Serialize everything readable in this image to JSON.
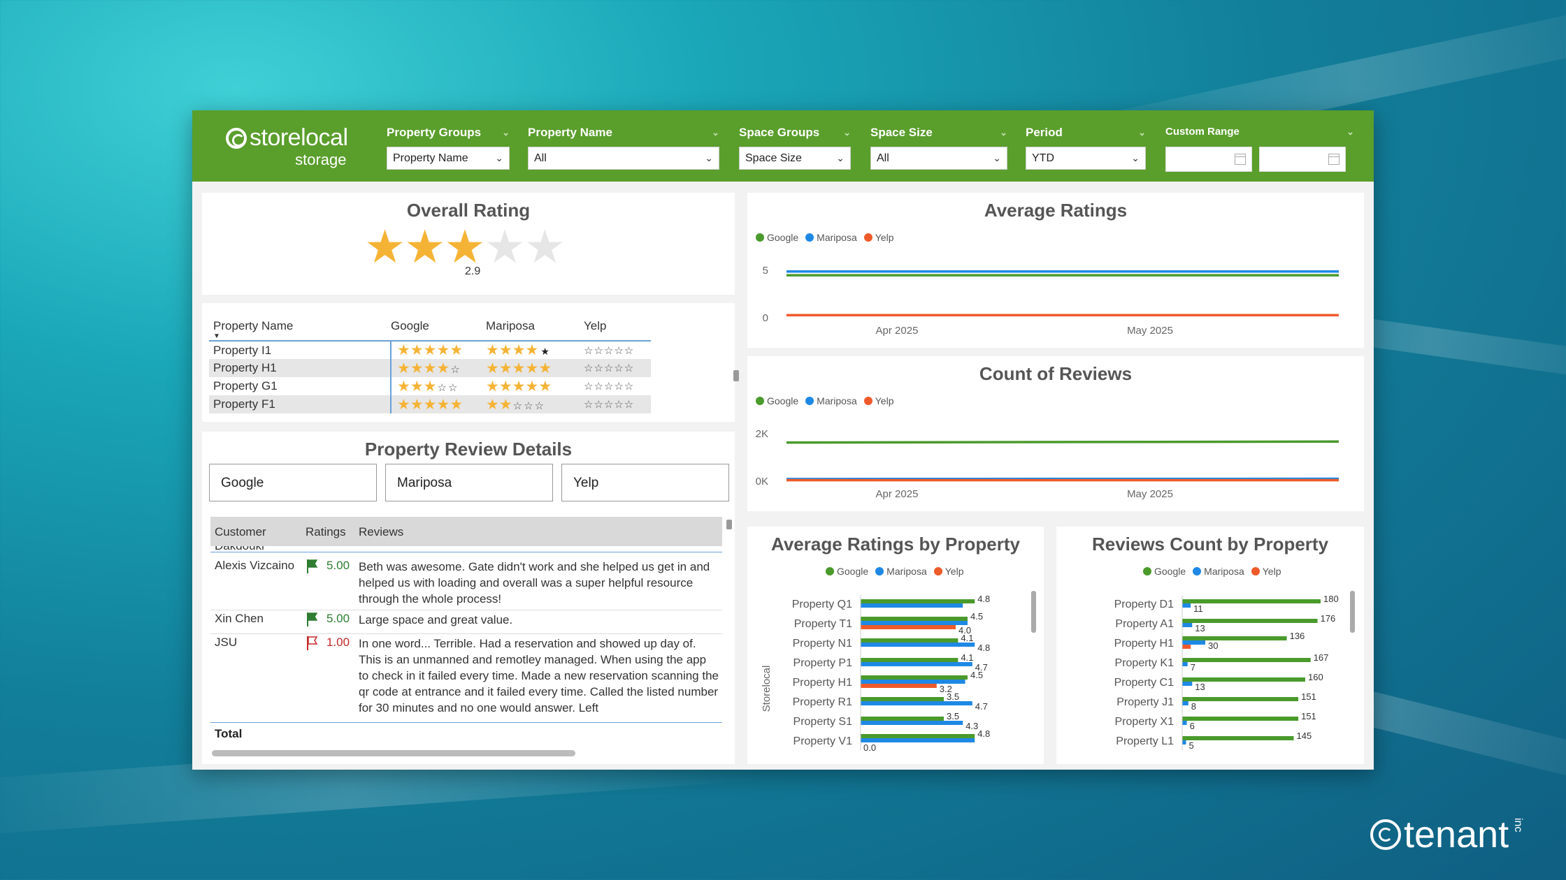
{
  "colors": {
    "google": "#4a9a2c",
    "mariposa": "#1e88e5",
    "yelp": "#ef5a2a",
    "brand_green": "#5a9e2c",
    "star": "#f5b335"
  },
  "header": {
    "logo_main": "storelocal",
    "logo_sub": "storage",
    "filters": [
      {
        "label": "Property Groups",
        "value": "Property Name"
      },
      {
        "label": "Property Name",
        "value": "All"
      },
      {
        "label": "Space Groups",
        "value": "Space Size"
      },
      {
        "label": "Space Size",
        "value": "All"
      },
      {
        "label": "Period",
        "value": "YTD"
      },
      {
        "label": "Custom Range",
        "value": ""
      }
    ]
  },
  "overall": {
    "title": "Overall Rating",
    "value": "2.9",
    "stars_filled": 3,
    "stars_total": 5
  },
  "property_table": {
    "headers": [
      "Property Name",
      "Google",
      "Mariposa",
      "Yelp"
    ],
    "rows": [
      {
        "name": "Property I1",
        "google": 5,
        "mariposa": 4.5,
        "yelp": 0
      },
      {
        "name": "Property H1",
        "google": 4,
        "mariposa": 5,
        "yelp": 0
      },
      {
        "name": "Property G1",
        "google": 3,
        "mariposa": 5,
        "yelp": 0
      },
      {
        "name": "Property F1",
        "google": 5,
        "mariposa": 2,
        "yelp": 0
      }
    ]
  },
  "review_details": {
    "title": "Property Review Details",
    "tabs": [
      "Google",
      "Mariposa",
      "Yelp"
    ],
    "columns": [
      "Customer",
      "Ratings",
      "Reviews"
    ],
    "partial_name": "Dakdouki",
    "rows": [
      {
        "customer": "Alexis Vizcaino",
        "rating": "5.00",
        "positive": true,
        "review": "Beth was awesome. Gate didn't work and she helped us get in and helped us with loading and overall was a super helpful resource through the whole process!"
      },
      {
        "customer": "Xin Chen",
        "rating": "5.00",
        "positive": true,
        "review": "Large space and great value."
      },
      {
        "customer": "JSU",
        "rating": "1.00",
        "positive": false,
        "review": "In one word... Terrible. Had a reservation and showed up day of. This is an unmanned and remotley managed. When using the app to check in it failed every time. Made a new reservation scanning the qr code at entrance and it failed every time. Called the listed number for 30 minutes and no one would answer. Left"
      }
    ],
    "total_label": "Total"
  },
  "legend": {
    "google": "Google",
    "mariposa": "Mariposa",
    "yelp": "Yelp"
  },
  "avg_ratings_chart": {
    "title": "Average Ratings",
    "y_ticks": [
      "5",
      "0"
    ],
    "x_ticks": [
      "Apr 2025",
      "May 2025"
    ]
  },
  "count_reviews_chart": {
    "title": "Count of Reviews",
    "y_ticks": [
      "2K",
      "0K"
    ],
    "x_ticks": [
      "Apr 2025",
      "May 2025"
    ]
  },
  "avg_by_property": {
    "title": "Average Ratings by Property",
    "axis_label": "Storelocal"
  },
  "count_by_property": {
    "title": "Reviews Count by Property"
  },
  "chart_data": [
    {
      "type": "line",
      "title": "Average Ratings",
      "x": [
        "Apr 2025",
        "May 2025"
      ],
      "ylim": [
        0,
        5
      ],
      "series": [
        {
          "name": "Google",
          "values": [
            4.4,
            4.4
          ]
        },
        {
          "name": "Mariposa",
          "values": [
            4.8,
            4.8
          ]
        },
        {
          "name": "Yelp",
          "values": [
            0.2,
            0.2
          ]
        }
      ]
    },
    {
      "type": "line",
      "title": "Count of Reviews",
      "x": [
        "Apr 2025",
        "May 2025"
      ],
      "ylim": [
        0,
        2500
      ],
      "series": [
        {
          "name": "Google",
          "values": [
            2000,
            2050
          ]
        },
        {
          "name": "Mariposa",
          "values": [
            80,
            90
          ]
        },
        {
          "name": "Yelp",
          "values": [
            20,
            20
          ]
        }
      ]
    },
    {
      "type": "bar",
      "title": "Average Ratings by Property",
      "categories": [
        "Property Q1",
        "Property T1",
        "Property N1",
        "Property P1",
        "Property H1",
        "Property R1",
        "Property S1",
        "Property V1"
      ],
      "series": [
        {
          "name": "Google",
          "values": [
            4.8,
            4.5,
            4.1,
            4.1,
            4.5,
            3.5,
            3.5,
            4.8
          ]
        },
        {
          "name": "Mariposa",
          "values": [
            4.3,
            4.5,
            4.8,
            4.7,
            4.4,
            4.7,
            4.3,
            4.8
          ]
        },
        {
          "name": "Yelp",
          "values": [
            null,
            4.0,
            null,
            null,
            3.2,
            null,
            null,
            0.0
          ]
        }
      ],
      "labels": [
        [
          "4.8"
        ],
        [
          "4.5",
          "4.0"
        ],
        [
          "4.1",
          "4.8"
        ],
        [
          "4.1",
          "4.7"
        ],
        [
          "4.5",
          "3.2"
        ],
        [
          "3.5",
          "4.7"
        ],
        [
          "3.5",
          "4.3"
        ],
        [
          "4.8",
          "0.0"
        ]
      ]
    },
    {
      "type": "bar",
      "title": "Reviews Count by Property",
      "categories": [
        "Property D1",
        "Property A1",
        "Property H1",
        "Property K1",
        "Property C1",
        "Property J1",
        "Property X1",
        "Property L1"
      ],
      "series": [
        {
          "name": "Google",
          "values": [
            180,
            176,
            136,
            167,
            160,
            151,
            151,
            145
          ]
        },
        {
          "name": "Mariposa",
          "values": [
            11,
            13,
            30,
            7,
            13,
            8,
            6,
            5
          ]
        },
        {
          "name": "Yelp",
          "values": [
            0,
            0,
            11,
            0,
            0,
            0,
            0,
            0
          ]
        }
      ]
    }
  ],
  "footer_logo": "tenant",
  "footer_logo_sup": "inc"
}
